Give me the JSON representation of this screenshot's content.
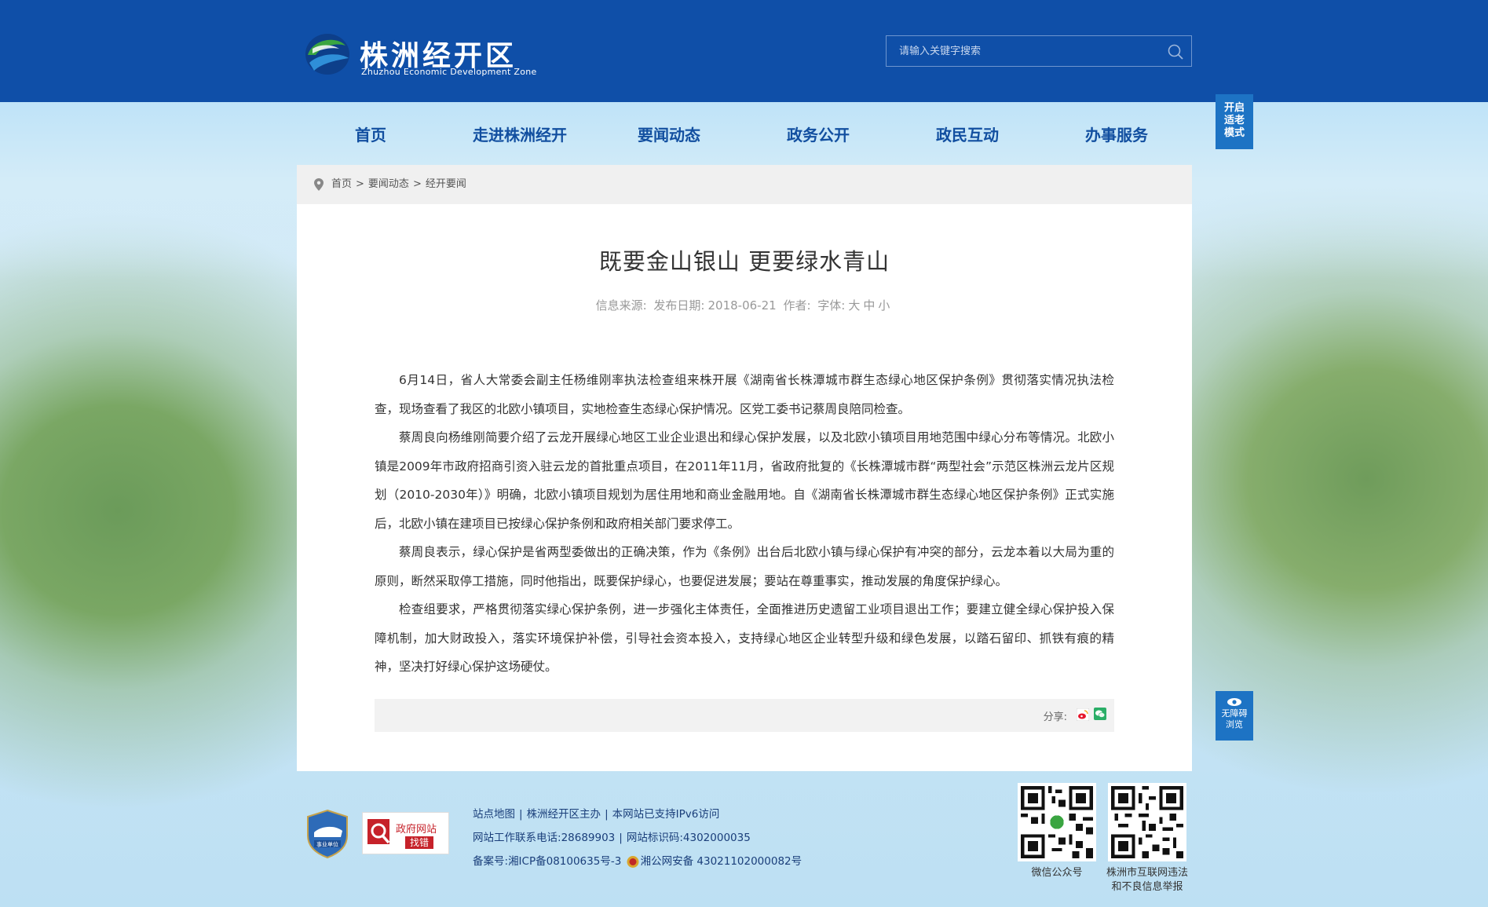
{
  "site": {
    "name_cn": "株洲经开区",
    "name_en": "Zhuzhou Economic Development Zone"
  },
  "search": {
    "placeholder": "请输入关键字搜索"
  },
  "nav": {
    "items": [
      {
        "label": "首页"
      },
      {
        "label": "走进株洲经开"
      },
      {
        "label": "要闻动态"
      },
      {
        "label": "政务公开"
      },
      {
        "label": "政民互动"
      },
      {
        "label": "办事服务"
      }
    ]
  },
  "side": {
    "elder_mode": [
      "开启",
      "适老",
      "模式"
    ],
    "accessibility": [
      "无障碍",
      "浏览"
    ]
  },
  "breadcrumb": [
    "首页",
    "要闻动态",
    "经开要闻"
  ],
  "article": {
    "title": "既要金山银山 更要绿水青山",
    "source_label": "信息来源:",
    "date_label": "发布日期:",
    "date": "2018-06-21",
    "author_label": "作者:",
    "font_label": "字体:",
    "font_sizes": [
      "大",
      "中",
      "小"
    ],
    "paragraphs": [
      "6月14日，省人大常委会副主任杨维刚率执法检查组来株开展《湖南省长株潭城市群生态绿心地区保护条例》贯彻落实情况执法检查，现场查看了我区的北欧小镇项目，实地检查生态绿心保护情况。区党工委书记蔡周良陪同检查。",
      "蔡周良向杨维刚简要介绍了云龙开展绿心地区工业企业退出和绿心保护发展，以及北欧小镇项目用地范围中绿心分布等情况。北欧小镇是2009年市政府招商引资入驻云龙的首批重点项目，在2011年11月，省政府批复的《长株潭城市群“两型社会”示范区株洲云龙片区规划（2010-2030年）》明确，北欧小镇项目规划为居住用地和商业金融用地。自《湖南省长株潭城市群生态绿心地区保护条例》正式实施后，北欧小镇在建项目已按绿心保护条例和政府相关部门要求停工。",
      "蔡周良表示，绿心保护是省两型委做出的正确决策，作为《条例》出台后北欧小镇与绿心保护有冲突的部分，云龙本着以大局为重的原则，断然采取停工措施，同时他指出，既要保护绿心，也要促进发展；要站在尊重事实，推动发展的角度保护绿心。",
      "检查组要求，严格贯彻落实绿心保护条例，进一步强化主体责任，全面推进历史遗留工业项目退出工作；要建立健全绿心保护投入保障机制，加大财政投入，落实环境保护补偿，引导社会资本投入，支持绿心地区企业转型升级和绿色发展，以踏石留印、抓铁有痕的精神，坚决打好绿心保护这场硬仗。"
    ],
    "share_label": "分享:"
  },
  "footer": {
    "badge_unit": "事业单位",
    "gov_site": "政府网站",
    "find_error": "找错",
    "links": [
      "站点地图",
      "株洲经开区主办",
      "本网站已支持IPv6访问"
    ],
    "phone_label": "网站工作联系电话:",
    "phone": "28689903",
    "site_id_label": "网站标识码:",
    "site_id": "4302000035",
    "icp_label": "备案号:",
    "icp": "湘ICP备08100635号-3",
    "police": "湘公网安备 43021102000082号",
    "qr1_label": "微信公众号",
    "qr2_label_1": "株洲市互联网违法",
    "qr2_label_2": "和不良信息举报"
  },
  "colors": {
    "header_bg": "#0f4fa8",
    "nav_text": "#124fa0",
    "side_btn": "#1d73c4"
  }
}
